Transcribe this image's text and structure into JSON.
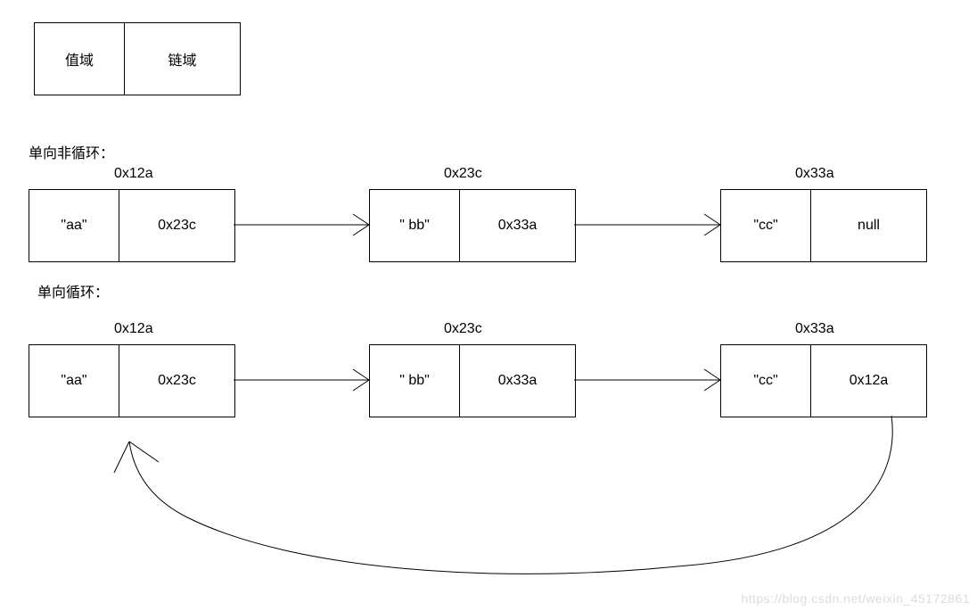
{
  "legend": {
    "value_field": "值域",
    "link_field": "链域"
  },
  "section1": {
    "title": "单向非循环：",
    "nodes": [
      {
        "addr": "0x12a",
        "value": "\"aa\"",
        "next": "0x23c"
      },
      {
        "addr": "0x23c",
        "value": "\" bb\"",
        "next": "0x33a"
      },
      {
        "addr": "0x33a",
        "value": "\"cc\"",
        "next": "null"
      }
    ]
  },
  "section2": {
    "title": "单向循环：",
    "nodes": [
      {
        "addr": "0x12a",
        "value": "\"aa\"",
        "next": "0x23c"
      },
      {
        "addr": "0x23c",
        "value": "\" bb\"",
        "next": "0x33a"
      },
      {
        "addr": "0x33a",
        "value": "\"cc\"",
        "next": "0x12a"
      }
    ]
  },
  "watermark": "https://blog.csdn.net/weixin_45172861"
}
